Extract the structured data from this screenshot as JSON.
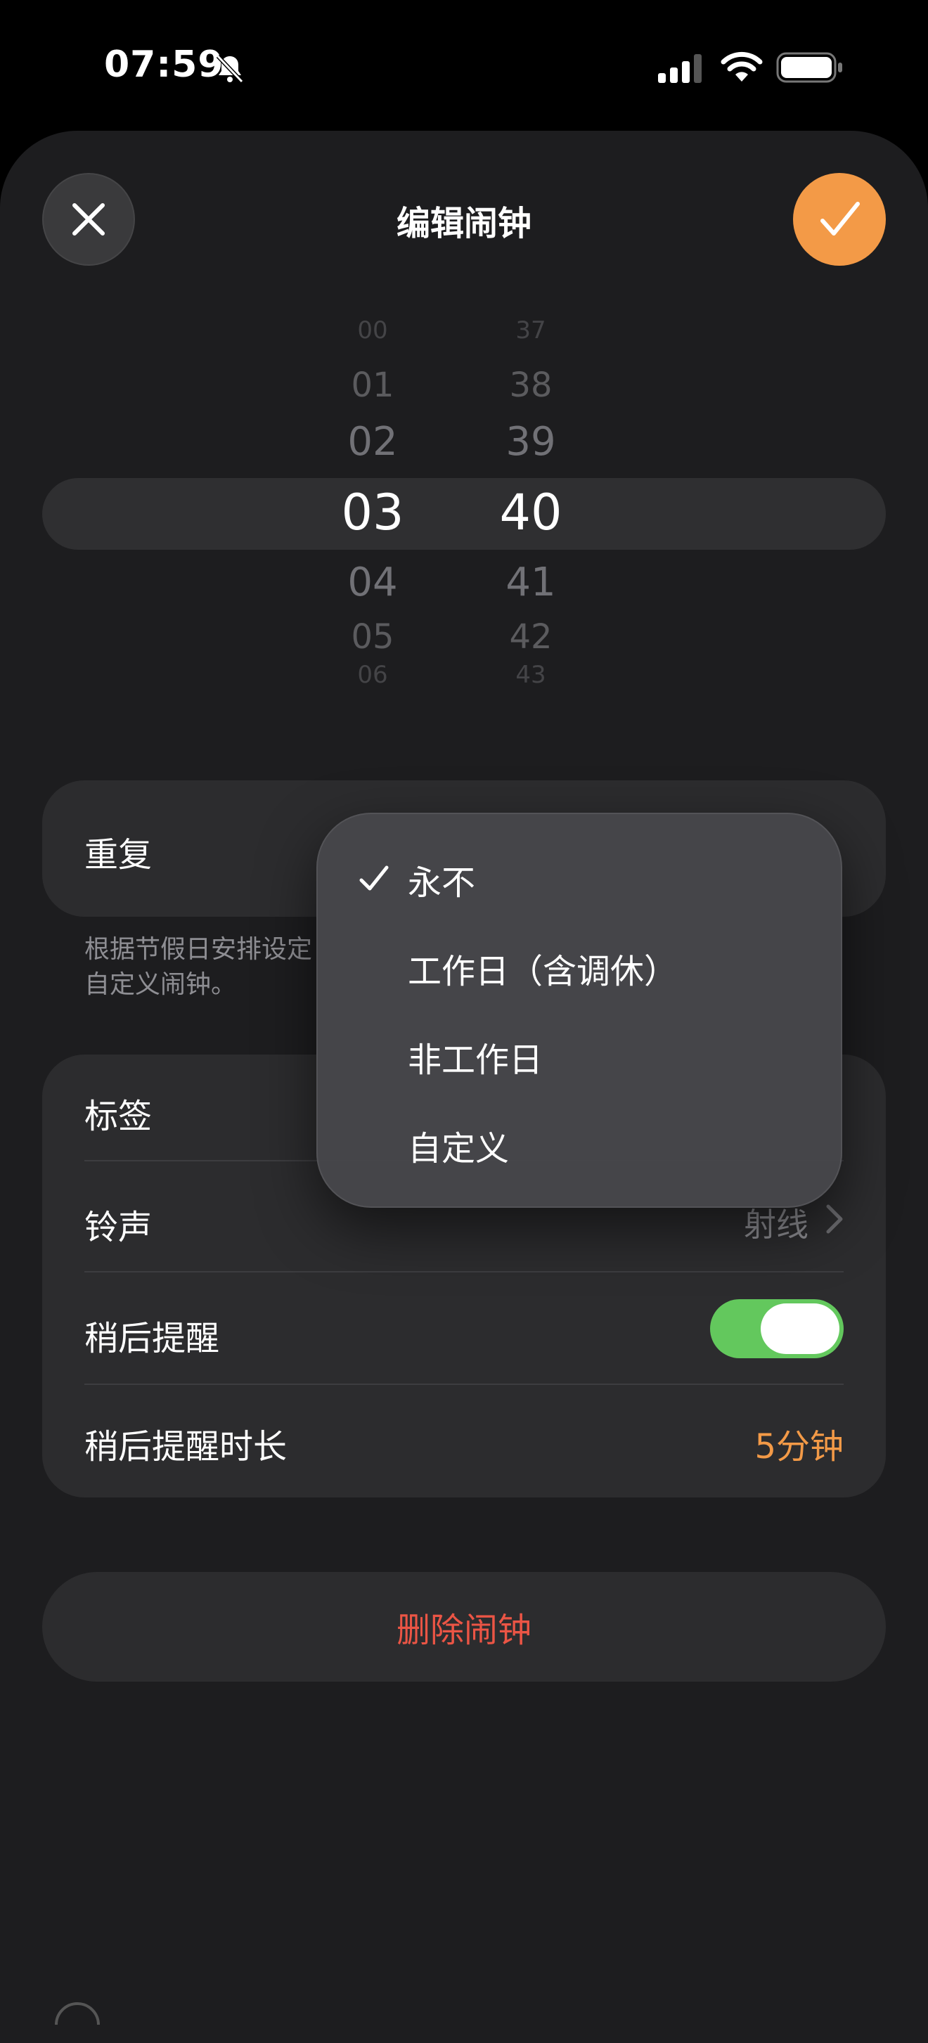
{
  "status_bar": {
    "time": "07:59",
    "icons": [
      "bell-slash-icon",
      "cellular-signal-icon",
      "wifi-icon",
      "battery-icon"
    ]
  },
  "header": {
    "title": "编辑闹钟",
    "close_icon": "close-icon",
    "confirm_icon": "checkmark-icon"
  },
  "time_picker": {
    "hours": [
      "00",
      "01",
      "02",
      "03",
      "04",
      "05",
      "06"
    ],
    "minutes": [
      "37",
      "38",
      "39",
      "40",
      "41",
      "42",
      "43"
    ],
    "selected_hour": "03",
    "selected_minute": "40"
  },
  "repeat": {
    "label": "重复",
    "hint_line1": "根据节假日安排设定",
    "hint_line2": "自定义闹钟。"
  },
  "repeat_menu": {
    "options": [
      "永不",
      "工作日（含调休）",
      "非工作日",
      "自定义"
    ],
    "selected": "永不"
  },
  "settings": {
    "label_row": "标签",
    "ringtone_row": "铃声",
    "ringtone_value": "射线",
    "snooze_row": "稍后提醒",
    "snooze_on": true,
    "snooze_duration_row": "稍后提醒时长",
    "snooze_duration_value": "5分钟"
  },
  "delete_button": "删除闹钟",
  "colors": {
    "accent": "#f39a47",
    "toggle_on": "#63c85d",
    "destructive": "#eb5545",
    "sheet_bg": "#1d1d1f",
    "card_bg": "#2c2c2e"
  }
}
